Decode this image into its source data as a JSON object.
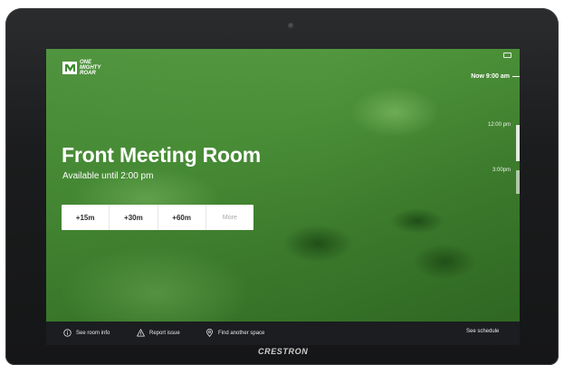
{
  "brand": {
    "logo_text": "ONE MIGHTY ROAR",
    "device_brand": "CRESTRON"
  },
  "schedule": {
    "now_label": "Now 9:00 am",
    "time_marks": [
      "12:00 pm",
      "3:00pm"
    ]
  },
  "room": {
    "title": "Front Meeting Room",
    "status": "Available until 2:00 pm"
  },
  "extend": {
    "options": [
      "+15m",
      "+30m",
      "+60m"
    ],
    "more_label": "More"
  },
  "footer": {
    "room_info": "See room info",
    "report_issue": "Report issue",
    "find_space": "Find another space",
    "see_schedule": "See schedule"
  },
  "icons": {
    "top_right": "screen-icon",
    "room_info": "info-circle-icon",
    "report_issue": "warning-triangle-icon",
    "find_space": "location-pin-icon"
  },
  "colors": {
    "accent_green": "#4c9139",
    "footer_bg": "#1b1d20"
  }
}
